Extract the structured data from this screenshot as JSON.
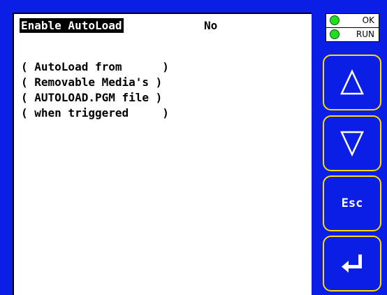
{
  "screen": {
    "menu_item": "Enable AutoLoad",
    "menu_value": "No",
    "help_lines": [
      "( AutoLoad from      )",
      "( Removable Media's )",
      "( AUTOLOAD.PGM file )",
      "( when triggered     )"
    ]
  },
  "status": {
    "ok_label": "OK",
    "run_label": "RUN",
    "led_color": "#22dd22"
  },
  "buttons": {
    "up_icon": "up-arrow-icon",
    "down_icon": "down-arrow-icon",
    "esc_label": "Esc",
    "enter_icon": "enter-icon"
  },
  "colors": {
    "bezel": "#0a1ee6",
    "button_border": "#ffdd00",
    "screen": "#ffffff"
  }
}
